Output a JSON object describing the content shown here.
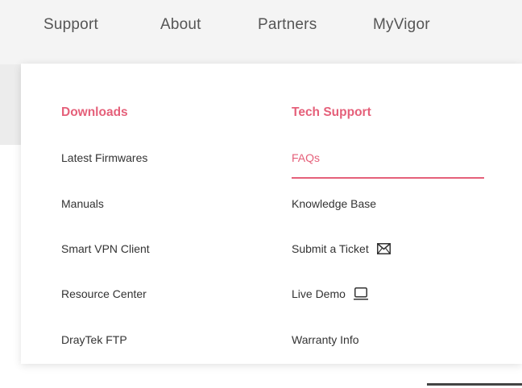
{
  "topnav": {
    "items": [
      {
        "label": "Support"
      },
      {
        "label": "About"
      },
      {
        "label": "Partners"
      },
      {
        "label": "MyVigor"
      }
    ]
  },
  "dropdown": {
    "downloads": {
      "heading": "Downloads",
      "links": [
        {
          "label": "Latest Firmwares"
        },
        {
          "label": "Manuals"
        },
        {
          "label": "Smart VPN Client"
        },
        {
          "label": "Resource Center"
        },
        {
          "label": "DrayTek FTP"
        }
      ]
    },
    "tech_support": {
      "heading": "Tech Support",
      "links": [
        {
          "label": "FAQs",
          "active": true
        },
        {
          "label": "Knowledge Base"
        },
        {
          "label": "Submit a Ticket",
          "icon": "envelope-icon"
        },
        {
          "label": "Live Demo",
          "icon": "laptop-icon"
        },
        {
          "label": "Warranty Info"
        }
      ]
    }
  },
  "colors": {
    "accent": "#e5607a",
    "text": "#333333",
    "nav_text": "#555555"
  }
}
